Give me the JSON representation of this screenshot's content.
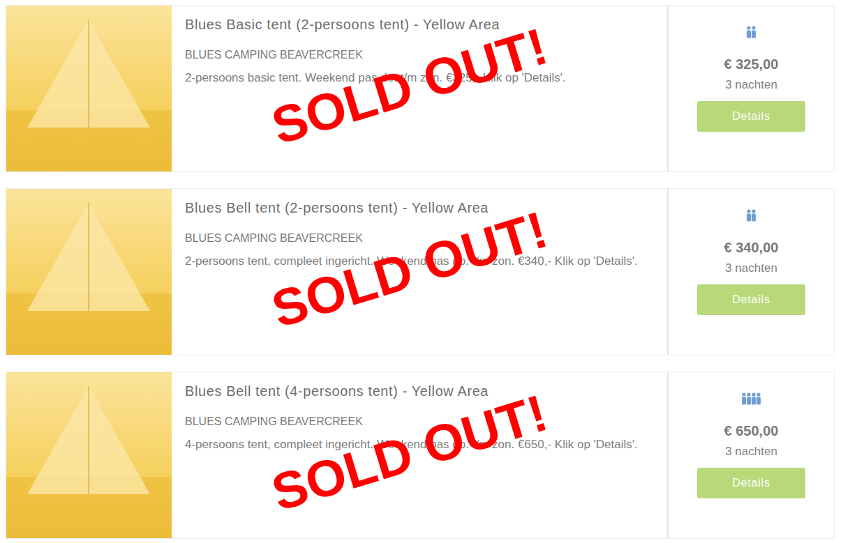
{
  "listings": [
    {
      "title": "Blues Basic tent (2-persoons tent) - Yellow Area",
      "subtitle": "BLUES CAMPING BEAVERCREEK",
      "description": "2-persoons basic tent. Weekend pas do. t/m zon. €325,- Klik op 'Details'.",
      "persons": 2,
      "price": "€ 325,00",
      "nights": "3 nachten",
      "button": "Details",
      "overlay": "SOLD OUT!",
      "sold_out": true
    },
    {
      "title": "Blues Bell tent (2-persoons tent) - Yellow Area",
      "subtitle": "BLUES CAMPING BEAVERCREEK",
      "description": "2-persoons tent, compleet ingericht. Weekend pas do. t/m zon. €340,- Klik op 'Details'.",
      "persons": 2,
      "price": "€ 340,00",
      "nights": "3 nachten",
      "button": "Details",
      "overlay": "SOLD OUT!",
      "sold_out": true
    },
    {
      "title": "Blues Bell tent (4-persoons tent) - Yellow Area",
      "subtitle": "BLUES CAMPING BEAVERCREEK",
      "description": "4-persoons tent, compleet ingericht. Weekend pas do. t/m zon. €650,- Klik op 'Details'.",
      "persons": 4,
      "price": "€ 650,00",
      "nights": "3 nachten",
      "button": "Details",
      "overlay": "SOLD OUT!",
      "sold_out": true
    }
  ]
}
